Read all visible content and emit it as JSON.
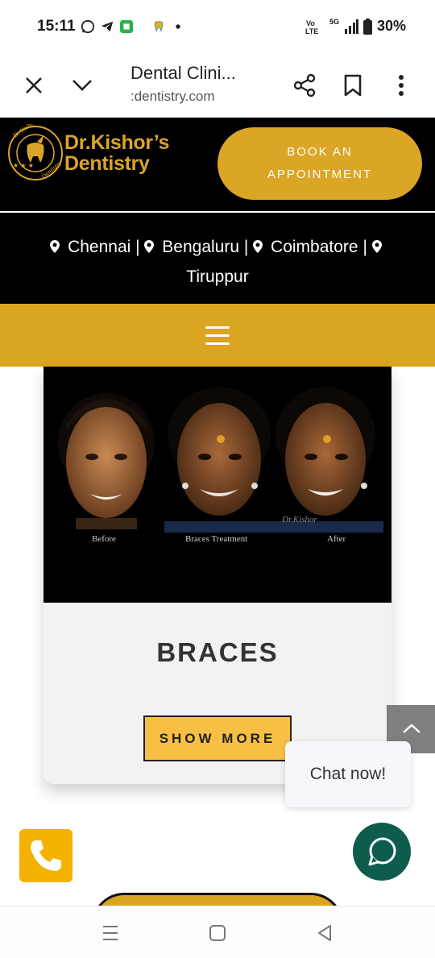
{
  "status_bar": {
    "time": "15:11",
    "battery": "30%",
    "network": "5G",
    "icons": [
      "whatsapp-icon",
      "telegram-icon",
      "app-icon",
      "dental-app-icon",
      "dot-icon",
      "volte-icon",
      "signal-icon",
      "battery-icon"
    ]
  },
  "browser": {
    "title": "Dental Clini...",
    "url": ":dentistry.com",
    "actions": [
      "close-icon",
      "chevron-down-icon",
      "share-icon",
      "bookmark-icon",
      "more-icon"
    ]
  },
  "header": {
    "logo_line1": "Dr.Kishor’s",
    "logo_line2": "Dentistry",
    "logo_badge_text": "Dr Kishor's Dentistry",
    "book_line1": "BOOK AN",
    "book_line2": "APPOINTMENT",
    "brand_color": "#DAA520"
  },
  "locations": {
    "items": [
      "Chennai",
      "Bengaluru",
      "Coimbatore",
      "Tiruppur"
    ],
    "separator": "|"
  },
  "card": {
    "image_captions": [
      "Before",
      "Braces Treatment",
      "After"
    ],
    "image_watermark": "Dr.Kishor",
    "title": "BRACES",
    "button": "SHOW MORE"
  },
  "floating": {
    "chat_bubble": "Chat now!"
  }
}
